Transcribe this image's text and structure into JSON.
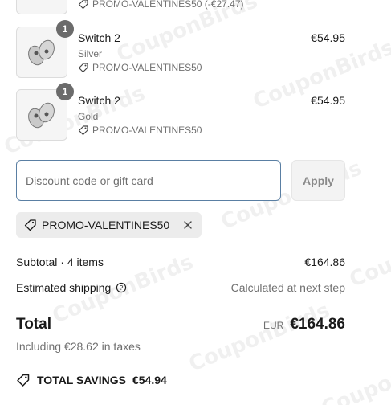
{
  "items_top": {
    "promo_text": "PROMO-VALENTINES50 (-€27.47)"
  },
  "items": [
    {
      "quantity": "1",
      "name": "Switch 2",
      "variant": "Silver",
      "promo": "PROMO-VALENTINES50",
      "price": "€54.95"
    },
    {
      "quantity": "1",
      "name": "Switch 2",
      "variant": "Gold",
      "promo": "PROMO-VALENTINES50",
      "price": "€54.95"
    }
  ],
  "discount": {
    "placeholder": "Discount code or gift card",
    "apply_label": "Apply",
    "applied_code": "PROMO-VALENTINES50"
  },
  "summary": {
    "subtotal_label": "Subtotal · 4 items",
    "subtotal_value": "€164.86",
    "shipping_label": "Estimated shipping",
    "shipping_value": "Calculated at next step",
    "total_label": "Total",
    "currency": "EUR",
    "total_value": "€164.86",
    "taxes_text": "Including €28.62 in taxes",
    "savings_label": "TOTAL SAVINGS",
    "savings_value": "€54.94"
  },
  "watermark": "CouponBirds",
  "colors": {
    "input_border": "#5a7fa3",
    "chip_bg": "#ececec",
    "muted_text": "#707070"
  }
}
